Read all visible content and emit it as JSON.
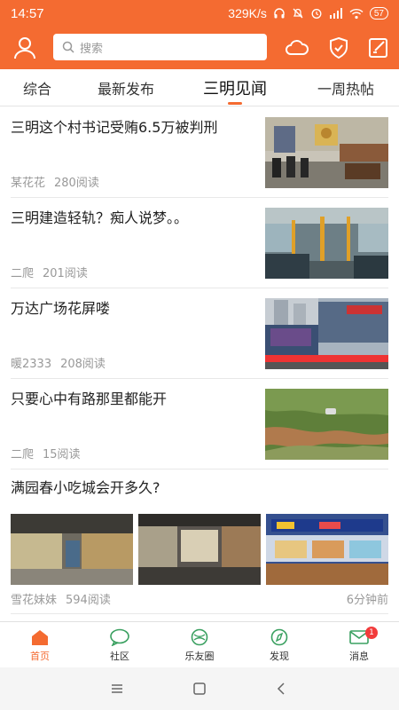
{
  "status_bar": {
    "time": "14:57",
    "speed": "329K/s",
    "battery": "57",
    "icons": [
      "headphones-icon",
      "mute-icon",
      "alarm-icon",
      "signal-icon",
      "wifi-icon",
      "battery-icon"
    ]
  },
  "header": {
    "search_placeholder": "搜索",
    "icons": [
      "user-icon",
      "search-icon",
      "cloud-icon",
      "shield-icon",
      "edit-icon"
    ],
    "accent_color": "#f46b31"
  },
  "tabs": [
    {
      "label": "综合",
      "active": false
    },
    {
      "label": "最新发布",
      "active": false
    },
    {
      "label": "三明见闻",
      "active": true
    },
    {
      "label": "一周热帖",
      "active": false
    }
  ],
  "feed": [
    {
      "title": "三明这个村书记受贿6.5万被判刑",
      "author": "某花花",
      "reads": "280阅读",
      "image": "courtroom"
    },
    {
      "title": "三明建造轻轨？痴人说梦。。",
      "author": "二爬",
      "reads": "201阅读",
      "image": "bus-interior"
    },
    {
      "title": "万达广场花屏喽",
      "author": "暖2333",
      "reads": "208阅读",
      "image": "plaza-screen"
    },
    {
      "title": "只要心中有路那里都能开",
      "author": "二爬",
      "reads": "15阅读",
      "image": "hillside-car"
    },
    {
      "title": "满园春小吃城会开多久?",
      "author": "雪花妹妹",
      "reads": "594阅读",
      "time": "6分钟前",
      "images": [
        "food-court-1",
        "food-court-2",
        "food-court-3"
      ]
    }
  ],
  "bottom_nav": [
    {
      "label": "首页",
      "icon": "home-icon",
      "active": true
    },
    {
      "label": "社区",
      "icon": "chat-icon",
      "active": false
    },
    {
      "label": "乐友圈",
      "icon": "circle-icon",
      "active": false
    },
    {
      "label": "发现",
      "icon": "compass-icon",
      "active": false
    },
    {
      "label": "消息",
      "icon": "mail-icon",
      "active": false,
      "badge": "1"
    }
  ],
  "system_nav": [
    "menu-icon",
    "home-square-icon",
    "back-icon"
  ]
}
